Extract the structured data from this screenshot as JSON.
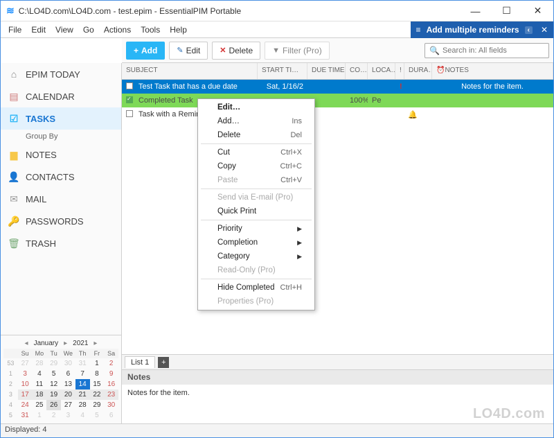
{
  "titlebar": {
    "title": "C:\\LO4D.com\\LO4D.com - test.epim - EssentialPIM Portable"
  },
  "menubar": [
    "File",
    "Edit",
    "View",
    "Go",
    "Actions",
    "Tools",
    "Help"
  ],
  "reminder_bar": {
    "label": "Add multiple reminders"
  },
  "toolbar": {
    "add": "Add",
    "edit": "Edit",
    "delete": "Delete",
    "filter": "Filter (Pro)"
  },
  "search": {
    "placeholder": "Search in: All fields"
  },
  "sidebar": {
    "items": [
      {
        "label": "EPIM TODAY"
      },
      {
        "label": "CALENDAR"
      },
      {
        "label": "TASKS"
      },
      {
        "label": "NOTES"
      },
      {
        "label": "CONTACTS"
      },
      {
        "label": "MAIL"
      },
      {
        "label": "PASSWORDS"
      },
      {
        "label": "TRASH"
      }
    ],
    "sub": "Group By"
  },
  "calendar": {
    "month": "January",
    "year": "2021",
    "weekhead": [
      "Su",
      "Mo",
      "Tu",
      "We",
      "Th",
      "Fr",
      "Sa"
    ],
    "weeks": [
      {
        "wn": "53",
        "days": [
          {
            "n": "27",
            "c": "out wk"
          },
          {
            "n": "28",
            "c": "out"
          },
          {
            "n": "29",
            "c": "out"
          },
          {
            "n": "30",
            "c": "out"
          },
          {
            "n": "31",
            "c": "out"
          },
          {
            "n": "1",
            "c": ""
          },
          {
            "n": "2",
            "c": "wk"
          }
        ]
      },
      {
        "wn": "1",
        "days": [
          {
            "n": "3",
            "c": "wk"
          },
          {
            "n": "4",
            "c": ""
          },
          {
            "n": "5",
            "c": ""
          },
          {
            "n": "6",
            "c": ""
          },
          {
            "n": "7",
            "c": ""
          },
          {
            "n": "8",
            "c": ""
          },
          {
            "n": "9",
            "c": "wk"
          }
        ]
      },
      {
        "wn": "2",
        "days": [
          {
            "n": "10",
            "c": "wk"
          },
          {
            "n": "11",
            "c": ""
          },
          {
            "n": "12",
            "c": ""
          },
          {
            "n": "13",
            "c": ""
          },
          {
            "n": "14",
            "c": "today"
          },
          {
            "n": "15",
            "c": ""
          },
          {
            "n": "16",
            "c": "wk"
          }
        ]
      },
      {
        "wn": "3",
        "days": [
          {
            "n": "17",
            "c": "wk selrow"
          },
          {
            "n": "18",
            "c": "selrow"
          },
          {
            "n": "19",
            "c": "selrow"
          },
          {
            "n": "20",
            "c": "selrow"
          },
          {
            "n": "21",
            "c": "selrow"
          },
          {
            "n": "22",
            "c": "selrow"
          },
          {
            "n": "23",
            "c": "wk selrow"
          }
        ]
      },
      {
        "wn": "4",
        "days": [
          {
            "n": "24",
            "c": "wk"
          },
          {
            "n": "25",
            "c": ""
          },
          {
            "n": "26",
            "c": "sel"
          },
          {
            "n": "27",
            "c": ""
          },
          {
            "n": "28",
            "c": ""
          },
          {
            "n": "29",
            "c": ""
          },
          {
            "n": "30",
            "c": "wk"
          }
        ]
      },
      {
        "wn": "5",
        "days": [
          {
            "n": "31",
            "c": "wk"
          },
          {
            "n": "1",
            "c": "out"
          },
          {
            "n": "2",
            "c": "out"
          },
          {
            "n": "3",
            "c": "out"
          },
          {
            "n": "4",
            "c": "out"
          },
          {
            "n": "5",
            "c": "out"
          },
          {
            "n": "6",
            "c": "out wk"
          }
        ]
      }
    ]
  },
  "columns": {
    "subject": "SUBJECT",
    "start": "START TI…",
    "due": "DUE TIME",
    "comp": "CO…",
    "loc": "LOCA…",
    "excl": "!",
    "dur": "DURA…",
    "notes": "NOTES"
  },
  "rows": [
    {
      "subject": "Test Task that has a due date",
      "start": "Sat, 1/16/2",
      "due": "",
      "co": "",
      "loc": "",
      "ex": "!",
      "dur": "",
      "notes": "Notes for the item.",
      "class": "sel-blue"
    },
    {
      "subject": "Completed Task",
      "start": "",
      "due": "",
      "co": "100%",
      "loc": "Pe",
      "ex": "",
      "dur": "",
      "notes": "",
      "class": "green",
      "checked": true
    },
    {
      "subject": "Task with a Remin",
      "start": "",
      "due": "",
      "co": "",
      "loc": "",
      "ex": "",
      "dur": "",
      "notes": "",
      "bell": true
    }
  ],
  "tabbar": {
    "tab1": "List 1"
  },
  "notes_section": {
    "title": "Notes",
    "body": "Notes for the item."
  },
  "status": {
    "text": "Displayed: 4"
  },
  "context": [
    {
      "t": "item",
      "label": "Edit…",
      "bold": true
    },
    {
      "t": "item",
      "label": "Add…",
      "sc": "Ins"
    },
    {
      "t": "item",
      "label": "Delete",
      "sc": "Del"
    },
    {
      "t": "sep"
    },
    {
      "t": "item",
      "label": "Cut",
      "sc": "Ctrl+X"
    },
    {
      "t": "item",
      "label": "Copy",
      "sc": "Ctrl+C"
    },
    {
      "t": "item",
      "label": "Paste",
      "sc": "Ctrl+V",
      "disabled": true
    },
    {
      "t": "sep"
    },
    {
      "t": "item",
      "label": "Send via E-mail (Pro)",
      "disabled": true
    },
    {
      "t": "item",
      "label": "Quick Print"
    },
    {
      "t": "sep"
    },
    {
      "t": "item",
      "label": "Priority",
      "sub": true
    },
    {
      "t": "item",
      "label": "Completion",
      "sub": true
    },
    {
      "t": "item",
      "label": "Category",
      "sub": true
    },
    {
      "t": "item",
      "label": "Read-Only (Pro)",
      "disabled": true
    },
    {
      "t": "sep"
    },
    {
      "t": "item",
      "label": "Hide Completed",
      "sc": "Ctrl+H"
    },
    {
      "t": "item",
      "label": "Properties (Pro)",
      "disabled": true
    }
  ],
  "watermark": "LO4D.com"
}
